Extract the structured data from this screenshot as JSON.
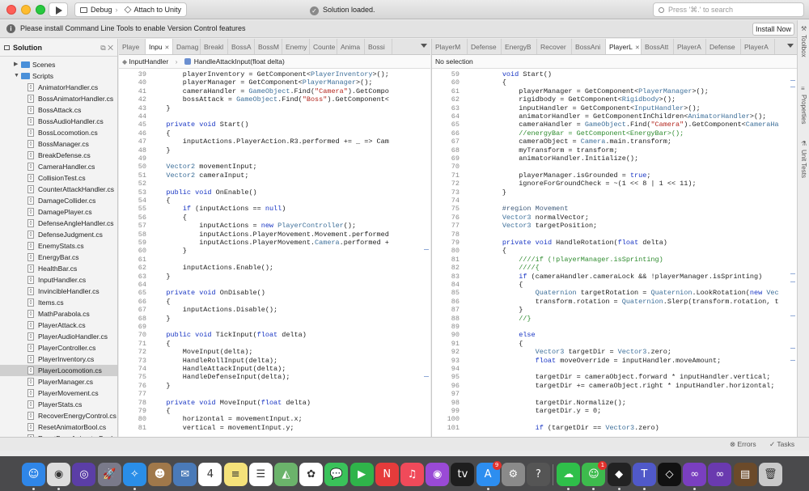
{
  "window": {
    "run_glyph": "▶",
    "scheme_label": "Debug",
    "target_label": "Attach to Unity",
    "status": "Solution loaded.",
    "search_placeholder": "Press '⌘.' to search"
  },
  "infobar": {
    "icon_glyph": "i",
    "message": "Please install Command Line Tools to enable Version Control features",
    "button": "Install Now"
  },
  "right_pads": [
    "Toolbox",
    "Properties",
    "Unit Tests"
  ],
  "solution": {
    "title": "Solution",
    "header_icons": "⧉ ✕",
    "folders": [
      "Scenes",
      "Scripts"
    ],
    "files": [
      "AnimatorHandler.cs",
      "BossAnimatorHandler.cs",
      "BossAttack.cs",
      "BossAudioHandler.cs",
      "BossLocomotion.cs",
      "BossManager.cs",
      "BreakDefense.cs",
      "CameraHandler.cs",
      "CollisionTest.cs",
      "CounterAttackHandler.cs",
      "DamageCollider.cs",
      "DamagePlayer.cs",
      "DefenseAngleHandler.cs",
      "DefenseJudgment.cs",
      "EnemyStats.cs",
      "EnergyBar.cs",
      "HealthBar.cs",
      "InputHandler.cs",
      "InvincibleHandler.cs",
      "Items.cs",
      "MathParabola.cs",
      "PlayerAttack.cs",
      "PlayerAudioHandler.cs",
      "PlayerController.cs",
      "PlayerInventory.cs",
      "PlayerLocomotion.cs",
      "PlayerManager.cs",
      "PlayerMovement.cs",
      "PlayerStats.cs",
      "RecoverEnergyControl.cs",
      "ResetAnimatorBool.cs",
      "ResetBossAnimatorBool.cs"
    ],
    "selected": "PlayerLocomotion.cs"
  },
  "editor_left": {
    "tabs": [
      "Playe",
      "Inpu",
      "Damag",
      "Breakl",
      "BossA",
      "BossM",
      "Enemy",
      "Counte",
      "Anima",
      "Bossi"
    ],
    "active_tab": 1,
    "crumb_class": "InputHandler",
    "crumb_member": "HandleAttackInput(float delta)",
    "lines": [
      {
        "n": "39",
        "code": "        playerInventory = GetComponent<PlayerInventory>();"
      },
      {
        "n": "40",
        "code": "        playerManager = GetComponent<PlayerManager>();"
      },
      {
        "n": "41",
        "code": "        cameraHandler = GameObject.Find(\"Camera\").GetCompo"
      },
      {
        "n": "42",
        "code": "        bossAttack = GameObject.Find(\"Boss\").GetComponent<"
      },
      {
        "n": "43",
        "code": "    }"
      },
      {
        "n": "44",
        "code": ""
      },
      {
        "n": "45",
        "code": "    private void Start()"
      },
      {
        "n": "46",
        "code": "    {"
      },
      {
        "n": "47",
        "code": "        inputActions.PlayerAction.R3.performed += _ => Cam"
      },
      {
        "n": "48",
        "code": "    }"
      },
      {
        "n": "49",
        "code": ""
      },
      {
        "n": "50",
        "code": "    Vector2 movementInput;"
      },
      {
        "n": "51",
        "code": "    Vector2 cameraInput;"
      },
      {
        "n": "52",
        "code": ""
      },
      {
        "n": "53",
        "code": "    public void OnEnable()"
      },
      {
        "n": "54",
        "code": "    {"
      },
      {
        "n": "55",
        "code": "        if (inputActions == null)"
      },
      {
        "n": "56",
        "code": "        {"
      },
      {
        "n": "57",
        "code": "            inputActions = new PlayerController();"
      },
      {
        "n": "58",
        "code": "            inputActions.PlayerMovement.Movement.performed"
      },
      {
        "n": "59",
        "code": "            inputActions.PlayerMovement.Camera.performed +"
      },
      {
        "n": "60",
        "code": "        }"
      },
      {
        "n": "61",
        "code": ""
      },
      {
        "n": "62",
        "code": "        inputActions.Enable();"
      },
      {
        "n": "63",
        "code": "    }"
      },
      {
        "n": "64",
        "code": ""
      },
      {
        "n": "65",
        "code": "    private void OnDisable()"
      },
      {
        "n": "66",
        "code": "    {"
      },
      {
        "n": "67",
        "code": "        inputActions.Disable();"
      },
      {
        "n": "68",
        "code": "    }"
      },
      {
        "n": "69",
        "code": ""
      },
      {
        "n": "70",
        "code": "    public void TickInput(float delta)"
      },
      {
        "n": "71",
        "code": "    {"
      },
      {
        "n": "72",
        "code": "        MoveInput(delta);"
      },
      {
        "n": "73",
        "code": "        HandleRollInput(delta);"
      },
      {
        "n": "74",
        "code": "        HandleAttackInput(delta);"
      },
      {
        "n": "75",
        "code": "        HandleDefenseInput(delta);"
      },
      {
        "n": "76",
        "code": "    }"
      },
      {
        "n": "77",
        "code": ""
      },
      {
        "n": "78",
        "code": "    private void MoveInput(float delta)"
      },
      {
        "n": "79",
        "code": "    {"
      },
      {
        "n": "80",
        "code": "        horizontal = movementInput.x;"
      },
      {
        "n": "81",
        "code": "        vertical = movementInput.y;"
      }
    ]
  },
  "editor_right": {
    "tabs": [
      "PlayerM",
      "Defense",
      "EnergyB",
      "Recover",
      "BossAni",
      "PlayerL",
      "BossAtt",
      "PlayerA",
      "Defense",
      "PlayerA"
    ],
    "active_tab": 5,
    "crumb": "No selection",
    "lines": [
      {
        "n": "59",
        "code": "        void Start()"
      },
      {
        "n": "60",
        "code": "        {"
      },
      {
        "n": "61",
        "code": "            playerManager = GetComponent<PlayerManager>();"
      },
      {
        "n": "62",
        "code": "            rigidbody = GetComponent<Rigidbody>();"
      },
      {
        "n": "63",
        "code": "            inputHandler = GetComponent<InputHandler>();"
      },
      {
        "n": "64",
        "code": "            animatorHandler = GetComponentInChildren<AnimatorHandler>();"
      },
      {
        "n": "65",
        "code": "            cameraHandler = GameObject.Find(\"Camera\").GetComponent<CameraHa"
      },
      {
        "n": "66",
        "code": "            //energyBar = GetComponent<EnergyBar>();"
      },
      {
        "n": "67",
        "code": "            cameraObject = Camera.main.transform;"
      },
      {
        "n": "68",
        "code": "            myTransform = transform;"
      },
      {
        "n": "69",
        "code": "            animatorHandler.Initialize();"
      },
      {
        "n": "70",
        "code": ""
      },
      {
        "n": "71",
        "code": "            playerManager.isGrounded = true;"
      },
      {
        "n": "72",
        "code": "            ignoreForGroundCheck = ~(1 << 8 | 1 << 11);"
      },
      {
        "n": "73",
        "code": "        }"
      },
      {
        "n": "74",
        "code": ""
      },
      {
        "n": "75",
        "code": "        #region Movement"
      },
      {
        "n": "76",
        "code": "        Vector3 normalVector;"
      },
      {
        "n": "77",
        "code": "        Vector3 targetPosition;"
      },
      {
        "n": "78",
        "code": ""
      },
      {
        "n": "79",
        "code": "        private void HandleRotation(float delta)"
      },
      {
        "n": "80",
        "code": "        {"
      },
      {
        "n": "81",
        "code": "            ////if (!playerManager.isSprinting)"
      },
      {
        "n": "82",
        "code": "            ////{"
      },
      {
        "n": "83",
        "code": "            if (cameraHandler.cameraLock && !playerManager.isSprinting)"
      },
      {
        "n": "84",
        "code": "            {"
      },
      {
        "n": "85",
        "code": "                Quaternion targetRotation = Quaternion.LookRotation(new Vec"
      },
      {
        "n": "86",
        "code": "                transform.rotation = Quaternion.Slerp(transform.rotation, t"
      },
      {
        "n": "87",
        "code": "            }"
      },
      {
        "n": "88",
        "code": "            //}"
      },
      {
        "n": "89",
        "code": ""
      },
      {
        "n": "90",
        "code": "            else"
      },
      {
        "n": "91",
        "code": "            {"
      },
      {
        "n": "92",
        "code": "                Vector3 targetDir = Vector3.zero;"
      },
      {
        "n": "93",
        "code": "                float moveOverride = inputHandler.moveAmount;"
      },
      {
        "n": "94",
        "code": ""
      },
      {
        "n": "95",
        "code": "                targetDir = cameraObject.forward * inputHandler.vertical;"
      },
      {
        "n": "96",
        "code": "                targetDir += cameraObject.right * inputHandler.horizontal;"
      },
      {
        "n": "97",
        "code": ""
      },
      {
        "n": "98",
        "code": "                targetDir.Normalize();"
      },
      {
        "n": "99",
        "code": "                targetDir.y = 0;"
      },
      {
        "n": "100",
        "code": ""
      },
      {
        "n": "101",
        "code": "                if (targetDir == Vector3.zero)"
      }
    ]
  },
  "bottom": {
    "errors": "Errors",
    "tasks": "Tasks"
  },
  "dock": {
    "apps": [
      {
        "name": "finder-icon",
        "color": "#2f86e8",
        "glyph": "☺"
      },
      {
        "name": "chrome-icon",
        "color": "#dddddd",
        "glyph": "◉"
      },
      {
        "name": "siri-icon",
        "color": "#5b3ea6",
        "glyph": "◎"
      },
      {
        "name": "launchpad-icon",
        "color": "#7a7a8a",
        "glyph": "🚀"
      },
      {
        "name": "safari-icon",
        "color": "#2a8ee8",
        "glyph": "✧"
      },
      {
        "name": "contacts-icon",
        "color": "#a0784a",
        "glyph": "☻"
      },
      {
        "name": "photos-app-icon",
        "color": "#4a7ab8",
        "glyph": "✉"
      },
      {
        "name": "calendar-icon",
        "color": "#ffffff",
        "glyph": "4"
      },
      {
        "name": "notes-icon",
        "color": "#f5e27a",
        "glyph": "≡"
      },
      {
        "name": "reminders-icon",
        "color": "#ffffff",
        "glyph": "☰"
      },
      {
        "name": "maps-icon",
        "color": "#6bb36b",
        "glyph": "◭"
      },
      {
        "name": "photos-icon",
        "color": "#ffffff",
        "glyph": "✿"
      },
      {
        "name": "messages-icon",
        "color": "#3ac25a",
        "glyph": "💬"
      },
      {
        "name": "facetime-icon",
        "color": "#2fb44a",
        "glyph": "▶"
      },
      {
        "name": "news-icon",
        "color": "#e63b3b",
        "glyph": "N"
      },
      {
        "name": "music-icon",
        "color": "#f04a5a",
        "glyph": "♫"
      },
      {
        "name": "podcasts-icon",
        "color": "#9a4ad6",
        "glyph": "◉"
      },
      {
        "name": "tv-icon",
        "color": "#1e1e1e",
        "glyph": "tv"
      },
      {
        "name": "appstore-icon",
        "color": "#2d8ef0",
        "glyph": "A",
        "badge": "9"
      },
      {
        "name": "preferences-icon",
        "color": "#8a8a8a",
        "glyph": "⚙"
      },
      {
        "name": "help-icon",
        "color": "#555555",
        "glyph": "?"
      },
      {
        "name": "cloud-icon",
        "color": "#2fbf4a",
        "glyph": "☁"
      },
      {
        "name": "wechat-icon",
        "color": "#3dbb4d",
        "glyph": "☺",
        "badge": "1"
      },
      {
        "name": "unity-icon",
        "color": "#222222",
        "glyph": "◆"
      },
      {
        "name": "teams-icon",
        "color": "#5059c9",
        "glyph": "T"
      },
      {
        "name": "unity-hub-icon",
        "color": "#111111",
        "glyph": "◇"
      },
      {
        "name": "visualstudio-icon",
        "color": "#7a3fc0",
        "glyph": "∞"
      },
      {
        "name": "visualstudio2-icon",
        "color": "#6a3aaf",
        "glyph": "∞"
      },
      {
        "name": "archive-icon",
        "color": "#6b4a2a",
        "glyph": "▤"
      },
      {
        "name": "trash-icon",
        "color": "#c9c9c9",
        "glyph": "🗑"
      }
    ]
  },
  "colors": {
    "keyword": "#1936c4",
    "type": "#3d6f99",
    "string": "#b3261e",
    "comment": "#2e8b2e",
    "selection": "#cfcfcf"
  }
}
